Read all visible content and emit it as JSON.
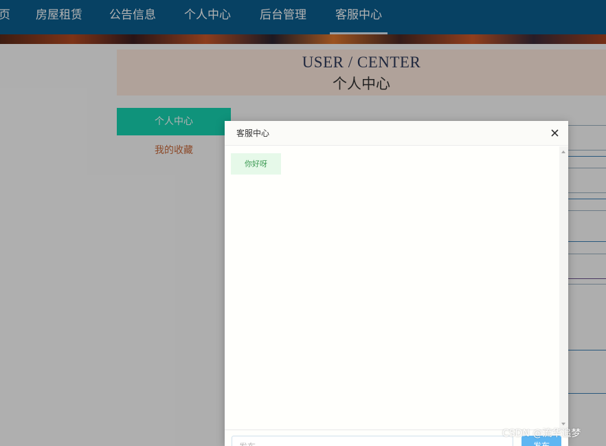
{
  "nav": {
    "items": [
      {
        "label": "页"
      },
      {
        "label": "房屋租赁"
      },
      {
        "label": "公告信息"
      },
      {
        "label": "个人中心"
      },
      {
        "label": "后台管理"
      },
      {
        "label": "客服中心",
        "active": true
      }
    ]
  },
  "page_header": {
    "title_en": "USER / CENTER",
    "title_cn": "个人中心"
  },
  "sidebar": {
    "items": [
      {
        "label": "个人中心",
        "active": true
      },
      {
        "label": "我的收藏"
      }
    ]
  },
  "dialog": {
    "title": "客服中心",
    "close_icon": "close-icon",
    "messages": [
      {
        "text": "你好呀"
      }
    ],
    "input_placeholder": "发布",
    "send_label": "发布"
  },
  "watermark": "CSDN @流华追梦",
  "colors": {
    "nav_bg": "#0b5d8f",
    "sidebar_active_bg": "#16d3b1",
    "send_button": "#5fb6f2",
    "message_bubble": "#e6f9e9"
  }
}
